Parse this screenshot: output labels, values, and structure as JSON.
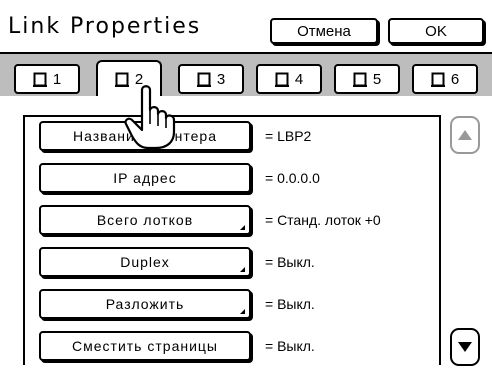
{
  "window": {
    "title": "Link Properties"
  },
  "header": {
    "cancel_label": "Отмена",
    "ok_label": "OK"
  },
  "tabs": [
    {
      "label": "1",
      "active": false
    },
    {
      "label": "2",
      "active": true
    },
    {
      "label": "3",
      "active": false
    },
    {
      "label": "4",
      "active": false
    },
    {
      "label": "5",
      "active": false
    },
    {
      "label": "6",
      "active": false
    }
  ],
  "settings": [
    {
      "button": "Название принтера",
      "value": "= LBP2",
      "dropdown": false
    },
    {
      "button": "IP адрес",
      "value": "= 0.0.0.0",
      "dropdown": false
    },
    {
      "button": "Всего лотков",
      "value": "= Станд. лоток +0",
      "dropdown": true
    },
    {
      "button": "Duplex",
      "value": "= Выкл.",
      "dropdown": true
    },
    {
      "button": "Разложить",
      "value": "= Выкл.",
      "dropdown": true
    },
    {
      "button": "Сместить страницы",
      "value": "= Выкл.",
      "dropdown": false
    }
  ],
  "scroll": {
    "up_icon": "triangle-up-icon",
    "down_icon": "triangle-down-icon"
  },
  "colors": {
    "tab_bar": "#bdbdbd",
    "disabled_scroll": "#999999"
  }
}
